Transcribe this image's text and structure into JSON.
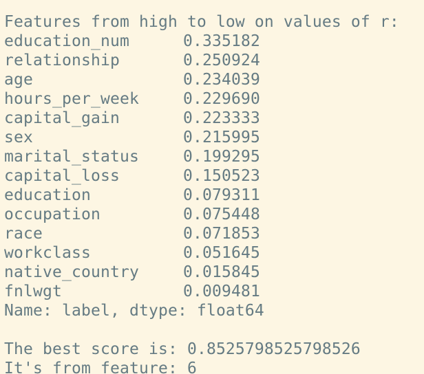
{
  "terminal": {
    "header": "Features from high to low on values of r:",
    "rows": [
      {
        "name": "education_num",
        "value": "0.335182"
      },
      {
        "name": "relationship",
        "value": "0.250924"
      },
      {
        "name": "age",
        "value": "0.234039"
      },
      {
        "name": "hours_per_week",
        "value": "0.229690"
      },
      {
        "name": "capital_gain",
        "value": "0.223333"
      },
      {
        "name": "sex",
        "value": "0.215995"
      },
      {
        "name": "marital_status",
        "value": "0.199295"
      },
      {
        "name": "capital_loss",
        "value": "0.150523"
      },
      {
        "name": "education",
        "value": "0.079311"
      },
      {
        "name": "occupation",
        "value": "0.075448"
      },
      {
        "name": "race",
        "value": "0.071853"
      },
      {
        "name": "workclass",
        "value": "0.051645"
      },
      {
        "name": "native_country",
        "value": "0.015845"
      },
      {
        "name": "fnlwgt",
        "value": "0.009481"
      }
    ],
    "series_info": "Name: label, dtype: float64",
    "best_score_line": "The best score is: 0.8525798525798526",
    "feature_line": "It's from feature: 6"
  },
  "colors": {
    "background": "#fdf6e3",
    "text": "#657b83",
    "partial_line": "#2aa198"
  }
}
